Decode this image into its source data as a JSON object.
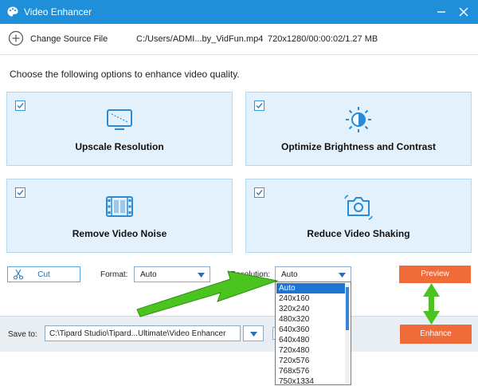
{
  "window": {
    "title": "Video Enhancer"
  },
  "source": {
    "change_label": "Change Source File",
    "path": "C:/Users/ADMI...by_VidFun.mp4",
    "info": "720x1280/00:00:02/1.27 MB"
  },
  "intro": "Choose the following options to enhance video quality.",
  "options": [
    {
      "label": "Upscale Resolution",
      "checked": true,
      "icon": "upscale-icon"
    },
    {
      "label": "Optimize Brightness and Contrast",
      "checked": true,
      "icon": "brightness-icon"
    },
    {
      "label": "Remove Video Noise",
      "checked": true,
      "icon": "film-noise-icon"
    },
    {
      "label": "Reduce Video Shaking",
      "checked": true,
      "icon": "camera-shake-icon"
    }
  ],
  "cut_label": "Cut",
  "format": {
    "label": "Format:",
    "value": "Auto"
  },
  "resolution": {
    "label": "Resolution:",
    "value": "Auto",
    "options": [
      "Auto",
      "240x160",
      "320x240",
      "480x320",
      "640x360",
      "640x480",
      "720x480",
      "720x576",
      "768x576",
      "750x1334"
    ],
    "selected_index": 0
  },
  "preview_label": "Preview",
  "enhance_label": "Enhance",
  "save_to": {
    "label": "Save to:",
    "path": "C:\\Tipard Studio\\Tipard...Ultimate\\Video Enhancer"
  },
  "colors": {
    "titlebar": "#1e8fd8",
    "card_bg": "#e3f1fc",
    "accent_orange": "#ef6b3a",
    "annotation_green": "#4cc41f"
  }
}
